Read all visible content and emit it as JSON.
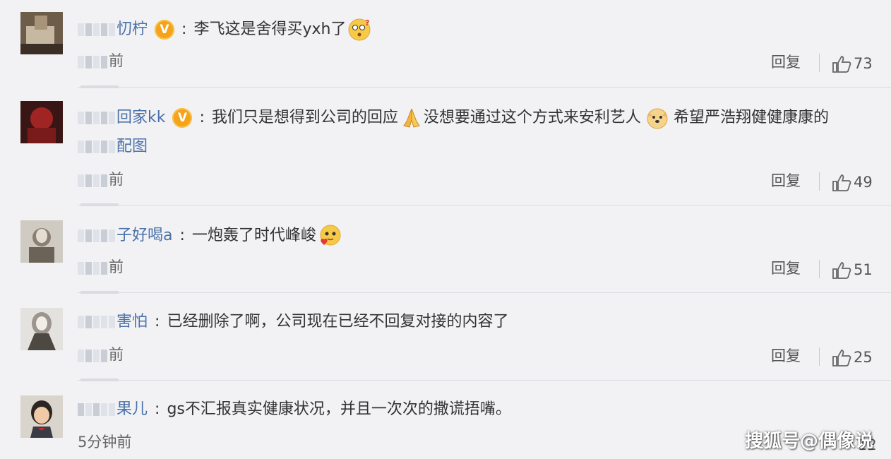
{
  "comments": [
    {
      "username": "忉柠",
      "verified": true,
      "text": "李飞这是舍得买yxh了",
      "emoji": "thinking-face-emoji",
      "extra_line": "",
      "time": "前",
      "reply_label": "回复",
      "likes": "73"
    },
    {
      "username": "回家kk",
      "verified": true,
      "text_before": "我们只是想得到公司的回应",
      "text_middle": "没想要通过这个方式来安利艺人",
      "text_after": "希望严浩翔健健康康的",
      "extra_line": "配图",
      "time": "前",
      "reply_label": "回复",
      "likes": "49"
    },
    {
      "username": "子好喝a",
      "verified": false,
      "text": "一炮轰了时代峰峻",
      "emoji": "love-face-emoji",
      "time": "前",
      "reply_label": "回复",
      "likes": "51"
    },
    {
      "username": "害怕",
      "verified": false,
      "text": "已经删除了啊，公司现在已经不回复对接的内容了",
      "time": "前",
      "reply_label": "回复",
      "likes": "25"
    },
    {
      "username": "果儿",
      "verified": false,
      "text": "gs不汇报真实健康状况，并且一次次的撒谎捂嘴。",
      "time": "5分钟前",
      "likes": "12"
    }
  ],
  "watermark": "搜狐号@偶像说",
  "colors": {
    "background": "#f2f2f5",
    "username": "#4a72a8",
    "verified_badge": "#f4a31b",
    "text": "#333333",
    "meta": "#666666"
  }
}
